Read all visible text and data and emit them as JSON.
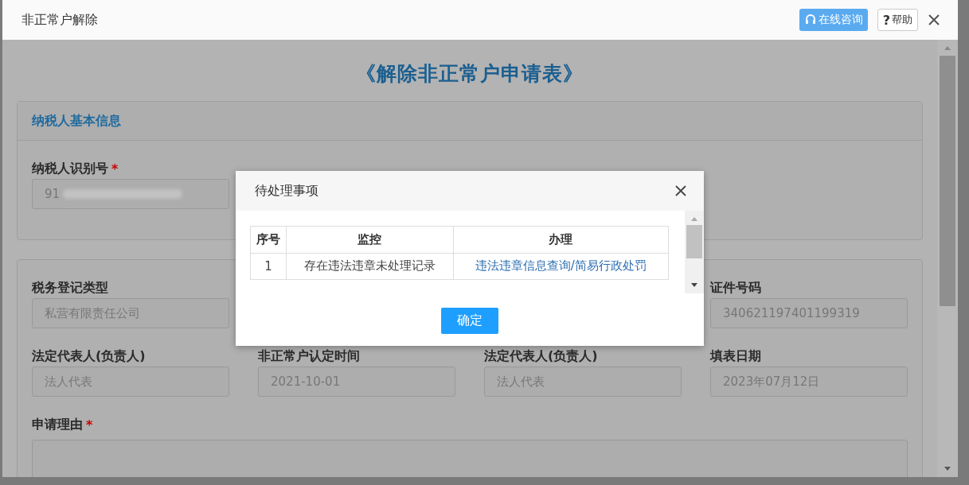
{
  "window": {
    "title": "非正常户解除",
    "buttons": [
      {
        "kind": "consult",
        "label": "在线咨询"
      },
      {
        "kind": "help",
        "icon": "?",
        "label": "帮助"
      }
    ]
  },
  "form": {
    "title": "《解除非正常户申请表》",
    "basic_section": {
      "heading": "纳税人基本信息",
      "fields": [
        {
          "label": "纳税人识别号",
          "required_mark": "*",
          "value": "91",
          "redacted": true
        }
      ]
    },
    "detail_rows": [
      [
        {
          "label": "税务登记类型",
          "value": "私营有限责任公司"
        },
        {
          "label": "证件号码",
          "value": "340621197401199319"
        }
      ],
      [
        {
          "label": "法定代表人(负责人)",
          "value": "法人代表"
        },
        {
          "label": "非正常户认定时间",
          "value": "2021-10-01"
        },
        {
          "label": "法定代表人(负责人)",
          "value": "法人代表"
        },
        {
          "label": "填表日期",
          "value": "2023年07月12日"
        }
      ]
    ],
    "reason": {
      "label": "申请理由",
      "required_mark": "*"
    }
  },
  "modal": {
    "title": "待处理事项",
    "columns": [
      "序号",
      "监控",
      "办理"
    ],
    "rows": [
      {
        "no": "1",
        "monitor": "存在违法违章未处理记录",
        "action": "违法违章信息查询/简易行政处罚"
      }
    ],
    "button": "确定"
  }
}
